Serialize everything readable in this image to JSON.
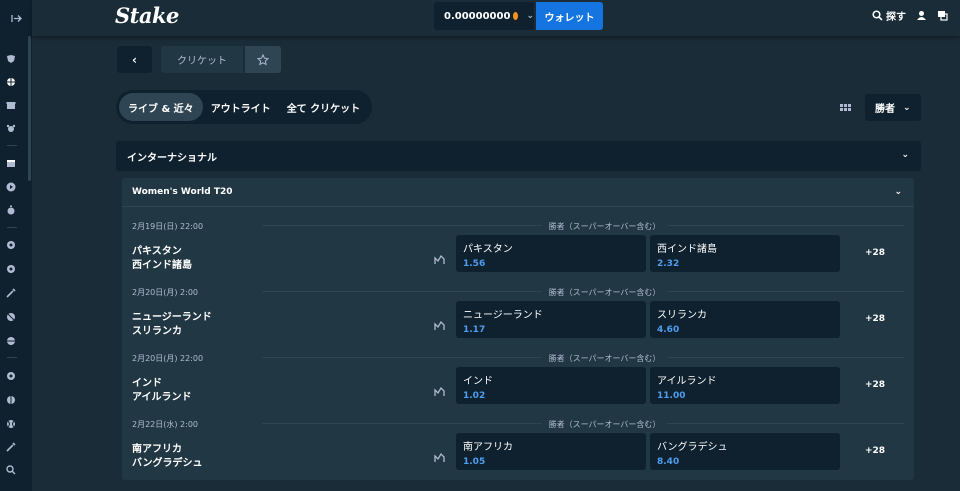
{
  "topbar": {
    "logo": "Stake",
    "balance": "0.00000000",
    "wallet_label": "ウォレット",
    "search_label": "探す"
  },
  "breadcrumb": {
    "current": "クリケット"
  },
  "tabs": [
    {
      "label": "ライブ & 近々",
      "active": true
    },
    {
      "label": "アウトライト",
      "active": false
    },
    {
      "label": "全て クリケット",
      "active": false
    }
  ],
  "market_select": {
    "value": "勝者"
  },
  "group": {
    "title": "インターナショナル",
    "league": "Women's World T20"
  },
  "matches": [
    {
      "date": "2月19日(日) 22:00",
      "market": "勝者（スーパーオーバー含む）",
      "team1": "パキスタン",
      "team2": "西インド諸島",
      "odds": [
        {
          "name": "パキスタン",
          "price": "1.56"
        },
        {
          "name": "西インド諸島",
          "price": "2.32"
        }
      ],
      "more": "+28"
    },
    {
      "date": "2月20日(月) 2:00",
      "market": "勝者（スーパーオーバー含む）",
      "team1": "ニュージーランド",
      "team2": "スリランカ",
      "odds": [
        {
          "name": "ニュージーランド",
          "price": "1.17"
        },
        {
          "name": "スリランカ",
          "price": "4.60"
        }
      ],
      "more": "+28"
    },
    {
      "date": "2月20日(月) 22:00",
      "market": "勝者（スーパーオーバー含む）",
      "team1": "インド",
      "team2": "アイルランド",
      "odds": [
        {
          "name": "インド",
          "price": "1.02"
        },
        {
          "name": "アイルランド",
          "price": "11.00"
        }
      ],
      "more": "+28"
    },
    {
      "date": "2月22日(水) 2:00",
      "market": "勝者（スーパーオーバー含む）",
      "team1": "南アフリカ",
      "team2": "バングラデシュ",
      "odds": [
        {
          "name": "南アフリカ",
          "price": "1.05"
        },
        {
          "name": "バングラデシュ",
          "price": "8.40"
        }
      ],
      "more": "+28"
    }
  ],
  "colors": {
    "background": "#1a2c38",
    "panel": "#0f212e",
    "accent": "#1475e1",
    "odds_text": "#4f9df0"
  },
  "icons": {
    "rail_toggle": "expand-arrow-icon",
    "rail": [
      "sport-icon",
      "ball-icon",
      "gift-icon",
      "paw-icon",
      "calendar-icon",
      "play-icon",
      "stopwatch-icon",
      "soccer-icon",
      "soccer-icon",
      "bat-icon",
      "ball-icon",
      "ball-icon",
      "soccer-icon",
      "ball-icon",
      "tennis-icon",
      "bat-icon",
      "search-icon"
    ]
  }
}
